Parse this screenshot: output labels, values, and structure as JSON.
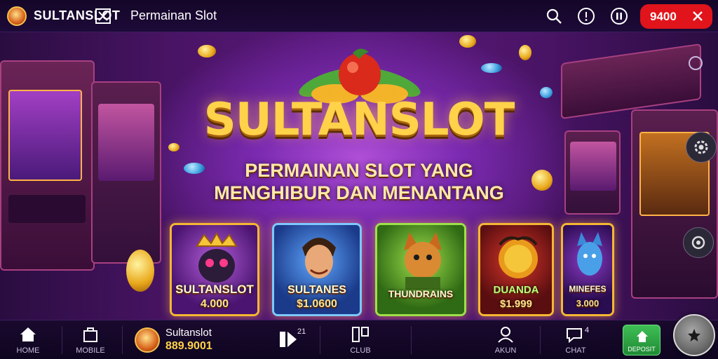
{
  "header": {
    "brand": "SULTANSLOT",
    "title": "Permainan Slot",
    "balance_button": "9400"
  },
  "hero": {
    "title": "SULTANSLOT",
    "subtitle_line1": "PERMAINAN SLOT YANG",
    "subtitle_line2": "MENGHIBUR DAN MENANTANG",
    "cards": [
      {
        "name": "SULTANSLOT",
        "value": "4.000"
      },
      {
        "name": "SULTANES",
        "value": "$1.0600"
      },
      {
        "name": "THUNDRAINS",
        "value": ""
      },
      {
        "name": "DUANDA",
        "value": "$1.999"
      },
      {
        "name": "MINEFES",
        "value": "3.000"
      }
    ]
  },
  "bottom_nav": {
    "home_label": "HOME",
    "bag_label": "MOBILE",
    "account_name": "Sultanslot",
    "account_balance": "889.9001",
    "icon3_badge": "21",
    "icon4_label": "CLUB",
    "user_label": "AKUN",
    "chat_label": "CHAT",
    "chat_badge": "4",
    "green_label": "DEPOSIT"
  },
  "colors": {
    "accent_red": "#e1141b",
    "gold": "#ffd24a",
    "deposit_green": "#2eaa45",
    "background": "#1a0b2e"
  },
  "icons": [
    "app-logo-icon",
    "brand-badge-icon",
    "search-icon",
    "info-icon",
    "pause-icon",
    "close-icon",
    "settings-icon",
    "refresh-icon",
    "home-icon",
    "bag-icon",
    "play-icon",
    "club-icon",
    "user-icon",
    "chat-icon",
    "deposit-icon",
    "star-icon"
  ]
}
